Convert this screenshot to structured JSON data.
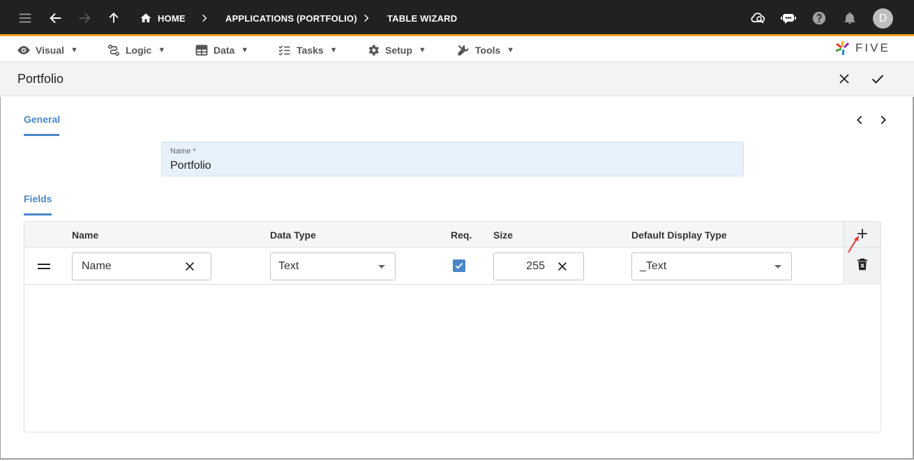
{
  "topbar": {
    "icons": [
      "menu-icon",
      "back-arrow-icon",
      "forward-arrow-icon",
      "up-arrow-icon",
      "home-icon",
      "cloud-sync-icon",
      "chat-bot-icon",
      "help-icon",
      "bell-icon"
    ],
    "breadcrumb": {
      "home": "HOME",
      "applications": "APPLICATIONS (PORTFOLIO)",
      "table_wizard": "TABLE WIZARD"
    },
    "avatar_letter": "D",
    "accent_color": "#f5a623"
  },
  "menubar": {
    "items": [
      {
        "label": "Visual",
        "icon": "eye-icon"
      },
      {
        "label": "Logic",
        "icon": "logic-icon"
      },
      {
        "label": "Data",
        "icon": "table-icon"
      },
      {
        "label": "Tasks",
        "icon": "checklist-icon"
      },
      {
        "label": "Setup",
        "icon": "gear-icon"
      },
      {
        "label": "Tools",
        "icon": "wrench-icon"
      }
    ],
    "caret": "▼",
    "logo_text": "FIVE"
  },
  "form": {
    "title": "Portfolio",
    "cancel_icon": "close-icon",
    "save_icon": "check-icon"
  },
  "general": {
    "tab_label": "General",
    "name_field": {
      "label": "Name *",
      "value": "Portfolio"
    }
  },
  "fields": {
    "tab_label": "Fields",
    "columns": [
      "Name",
      "Data Type",
      "Req.",
      "Size",
      "Default Display Type"
    ],
    "rows": [
      {
        "name": "Name",
        "data_type": "Text",
        "required": true,
        "size": "255",
        "default_display_type": "_Text"
      }
    ]
  },
  "colors": {
    "accent_blue": "#4a86c8",
    "annotation_red": "#e53935"
  }
}
